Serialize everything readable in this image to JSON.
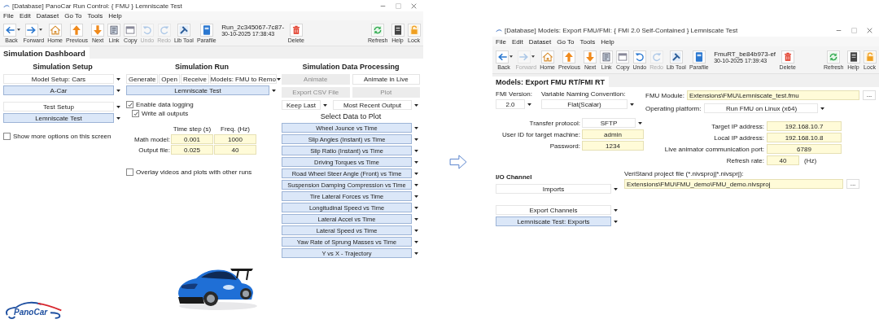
{
  "windows": [
    {
      "kind": "dashboard",
      "title": "[Database] PanoCar Run Control: { FMU } Lemniscate Test",
      "menu": [
        "File",
        "Edit",
        "Dataset",
        "Go To",
        "Tools",
        "Help"
      ],
      "toolbar": [
        {
          "label": "Back",
          "kind": "back",
          "dropdown": true,
          "disabled": false
        },
        {
          "label": "Forward",
          "kind": "forward",
          "dropdown": true,
          "disabled": false
        },
        {
          "label": "Home",
          "kind": "home",
          "disabled": false
        },
        {
          "label": "Previous",
          "kind": "previous",
          "disabled": false
        },
        {
          "label": "Next",
          "kind": "next",
          "disabled": false
        },
        {
          "label": "Link",
          "kind": "link",
          "disabled": false
        },
        {
          "label": "Copy",
          "kind": "copy",
          "disabled": false
        },
        {
          "label": "Undo",
          "kind": "undo",
          "disabled": true
        },
        {
          "label": "Redo",
          "kind": "redo",
          "disabled": true
        },
        {
          "label": "Lib Tool",
          "kind": "libtool",
          "disabled": false
        },
        {
          "label": "Parafile",
          "kind": "parafile",
          "disabled": false
        }
      ],
      "run": {
        "name": "Run_2c345067-7c87-",
        "date": "30-10-2025 17:38:43"
      },
      "delete_tool": {
        "label": "Delete",
        "kind": "delete",
        "disabled": false
      },
      "right_tools": [
        {
          "label": "Refresh",
          "kind": "refresh",
          "disabled": false
        },
        {
          "label": "Help",
          "kind": "help",
          "disabled": false
        },
        {
          "label": "Lock",
          "kind": "lock",
          "disabled": false
        }
      ],
      "tab": "Simulation Dashboard",
      "setup": {
        "title": "Simulation Setup",
        "groups": [
          [
            {
              "text": "Model Setup: Cars",
              "highlighted": false
            },
            {
              "text": "A-Car",
              "highlighted": true
            }
          ],
          [
            {
              "text": "Test Setup",
              "highlighted": false
            },
            {
              "text": "Lemniscate Test",
              "highlighted": true
            }
          ]
        ],
        "option": {
          "label": "Show more options on this screen",
          "checked": false
        }
      },
      "run_section": {
        "title": "Simulation Run",
        "buttons": [
          {
            "label": "Generate",
            "disabled": false
          },
          {
            "label": "Open",
            "disabled": false
          },
          {
            "label": "Receive",
            "disabled": false
          }
        ],
        "model_dropdown": {
          "text": "Models: FMU to Remo",
          "highlighted": false
        },
        "test_dropdown": {
          "text": "Lemniscate Test",
          "highlighted": true
        },
        "logging": {
          "label": "Enable data logging",
          "checked": true,
          "children": [
            {
              "label": "Write all outputs",
              "checked": true
            }
          ]
        },
        "timing": {
          "columns": [
            "Time step (s)",
            "Freq. (Hz)"
          ],
          "rows": [
            {
              "label": "Math model:",
              "values": [
                "0.001",
                "1000"
              ]
            },
            {
              "label": "Output file:",
              "values": [
                "0.025",
                "40"
              ]
            }
          ]
        },
        "overlay": {
          "label": "Overlay videos and plots with other runs",
          "checked": false
        }
      },
      "processing": {
        "title": "Simulation Data Processing",
        "buttons": [
          {
            "label": "Animate",
            "disabled": true
          },
          {
            "label": "Animate in Live",
            "disabled": false
          },
          {
            "label": "Export CSV File",
            "disabled": true
          },
          {
            "label": "Plot",
            "disabled": true
          }
        ],
        "selectors": [
          {
            "text": "Keep Last",
            "highlighted": false
          },
          {
            "text": "Most Recent Output",
            "highlighted": false
          }
        ],
        "plot_heading": "Select Data to Plot",
        "plots": [
          {
            "text": "Wheel Jounce vs Time",
            "highlighted": true
          },
          {
            "text": "Slip Angles (Instant) vs Time",
            "highlighted": true
          },
          {
            "text": "Slip Ratio (Instant) vs Time",
            "highlighted": true
          },
          {
            "text": "Driving Torques vs Time",
            "highlighted": true
          },
          {
            "text": "Road Wheel Steer Angle (Front) vs Time",
            "highlighted": true
          },
          {
            "text": "Suspension Damping Compression vs Time",
            "highlighted": true
          },
          {
            "text": "Tire Lateral Forces vs Time",
            "highlighted": true
          },
          {
            "text": "Longitudinal Speed vs Time",
            "highlighted": true
          },
          {
            "text": "Lateral Accel vs Time",
            "highlighted": true
          },
          {
            "text": "Lateral Speed vs Time",
            "highlighted": true
          },
          {
            "text": "Yaw Rate of Sprung Masses vs Time",
            "highlighted": true
          },
          {
            "text": "Y vs X - Trajectory",
            "highlighted": true
          }
        ]
      },
      "car_image": {
        "kind": "picture"
      },
      "logo": "PanoCar"
    },
    {
      "kind": "export",
      "title": "[Database] Models: Export FMU/FMI: { FMI 2.0 Self-Contained } Lemniscate Test",
      "menu": [
        "File",
        "Edit",
        "Dataset",
        "Go To",
        "Tools",
        "Help"
      ],
      "toolbar": [
        {
          "label": "Back",
          "kind": "back",
          "dropdown": true,
          "disabled": false
        },
        {
          "label": "Forward",
          "kind": "forward",
          "dropdown": true,
          "disabled": true
        },
        {
          "label": "Home",
          "kind": "home",
          "disabled": false
        },
        {
          "label": "Previous",
          "kind": "previous",
          "disabled": false
        },
        {
          "label": "Next",
          "kind": "next",
          "disabled": false
        },
        {
          "label": "Link",
          "kind": "link",
          "disabled": false
        },
        {
          "label": "Copy",
          "kind": "copy",
          "disabled": false
        },
        {
          "label": "Undo",
          "kind": "undo",
          "disabled": false
        },
        {
          "label": "Redo",
          "kind": "redo",
          "disabled": true
        },
        {
          "label": "Lib Tool",
          "kind": "libtool",
          "disabled": false
        },
        {
          "label": "Parafile",
          "kind": "parafile",
          "disabled": false
        }
      ],
      "run": {
        "name": "FmuRT_be84b973-ef",
        "date": "30-10-2025 17:39:43"
      },
      "delete_tool": {
        "label": "Delete",
        "kind": "delete",
        "disabled": false
      },
      "right_tools": [
        {
          "label": "Refresh",
          "kind": "refresh",
          "disabled": false
        },
        {
          "label": "Help",
          "kind": "help",
          "disabled": false
        },
        {
          "label": "Lock",
          "kind": "lock",
          "disabled": false
        }
      ],
      "tab": "Models: Export FMU RT/FMI RT",
      "fmi_version": {
        "label": "FMI Version:",
        "text": "2.0"
      },
      "naming": {
        "label": "Variable Naming Convention:",
        "text": "Flat(Scalar)"
      },
      "module": {
        "label": "FMU Module:",
        "value": "Extensions\\FMU\\Lemniscate_test.fmu",
        "browse": "..."
      },
      "platform": {
        "label": "Operating platform:",
        "text": "Run FMU on Linux (x64)"
      },
      "transfer": {
        "label": "Transfer protocol:",
        "text": "SFTP"
      },
      "credentials": [
        {
          "label": "User ID for target machine:",
          "value": "admin"
        },
        {
          "label": "Password:",
          "value": "1234"
        }
      ],
      "network": [
        {
          "label": "Target IP address:",
          "value": "192.168.10.7"
        },
        {
          "label": "Local IP address:",
          "value": "192.168.10.8"
        },
        {
          "label": "Live animator communication port:",
          "value": "6789"
        },
        {
          "label": "Refresh rate:",
          "value": "40",
          "unit": "(Hz)"
        }
      ],
      "io": {
        "title": "I/O Channel",
        "imports": {
          "text": "Imports",
          "highlighted": false
        },
        "exports": [
          {
            "text": "Export Channels",
            "highlighted": false
          },
          {
            "text": "Lemniscate Test: Exports",
            "highlighted": true
          }
        ]
      },
      "project": {
        "label": "VeriStand project file (*.nivsproj|*.nivsprj):",
        "value": "Extensions\\FMU\\FMU_demo\\FMU_demo.nivsproj",
        "browse": "..."
      }
    }
  ]
}
